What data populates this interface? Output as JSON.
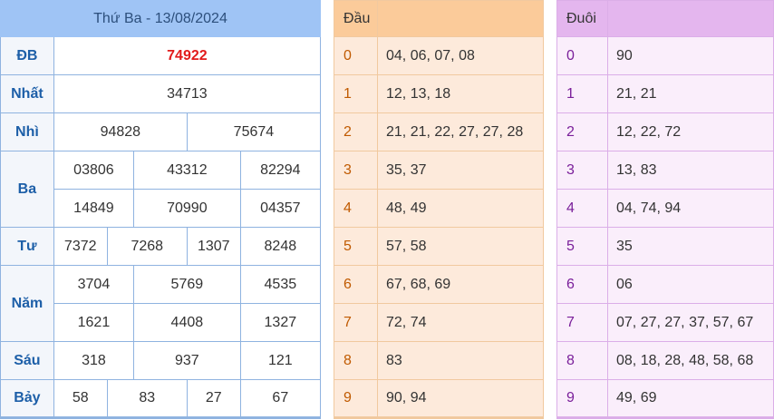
{
  "results": {
    "title": "Thứ Ba - 13/08/2024",
    "rows": [
      {
        "label": "ĐB",
        "values": [
          "74922"
        ]
      },
      {
        "label": "Nhất",
        "values": [
          "34713"
        ]
      },
      {
        "label": "Nhì",
        "values": [
          "94828",
          "75674"
        ]
      },
      {
        "label": "Ba",
        "values": [
          "03806",
          "43312",
          "82294",
          "14849",
          "70990",
          "04357"
        ]
      },
      {
        "label": "Tư",
        "values": [
          "7372",
          "7268",
          "1307",
          "8248"
        ]
      },
      {
        "label": "Năm",
        "values": [
          "3704",
          "5769",
          "4535",
          "1621",
          "4408",
          "1327"
        ]
      },
      {
        "label": "Sáu",
        "values": [
          "318",
          "937",
          "121"
        ]
      },
      {
        "label": "Bảy",
        "values": [
          "58",
          "83",
          "27",
          "67"
        ]
      }
    ]
  },
  "dau": {
    "header": "Đầu",
    "rows": [
      {
        "digit": "0",
        "values": "04, 06, 07, 08"
      },
      {
        "digit": "1",
        "values": "12, 13, 18"
      },
      {
        "digit": "2",
        "values": "21, 21, 22, 27, 27, 28"
      },
      {
        "digit": "3",
        "values": "35, 37"
      },
      {
        "digit": "4",
        "values": "48, 49"
      },
      {
        "digit": "5",
        "values": "57, 58"
      },
      {
        "digit": "6",
        "values": "67, 68, 69"
      },
      {
        "digit": "7",
        "values": "72, 74"
      },
      {
        "digit": "8",
        "values": "83"
      },
      {
        "digit": "9",
        "values": "90, 94"
      }
    ]
  },
  "duoi": {
    "header": "Đuôi",
    "rows": [
      {
        "digit": "0",
        "values": "90"
      },
      {
        "digit": "1",
        "values": "21, 21"
      },
      {
        "digit": "2",
        "values": "12, 22, 72"
      },
      {
        "digit": "3",
        "values": "13, 83"
      },
      {
        "digit": "4",
        "values": "04, 74, 94"
      },
      {
        "digit": "5",
        "values": "35"
      },
      {
        "digit": "6",
        "values": "06"
      },
      {
        "digit": "7",
        "values": "07, 27, 27, 37, 57, 67"
      },
      {
        "digit": "8",
        "values": "08, 18, 28, 48, 58, 68"
      },
      {
        "digit": "9",
        "values": "49, 69"
      }
    ]
  },
  "colors": {
    "special_prize": "#e21b1b",
    "results_header": "#9fc4f5",
    "dau_header": "#fbcb9a",
    "duoi_header": "#e4b6ee"
  }
}
